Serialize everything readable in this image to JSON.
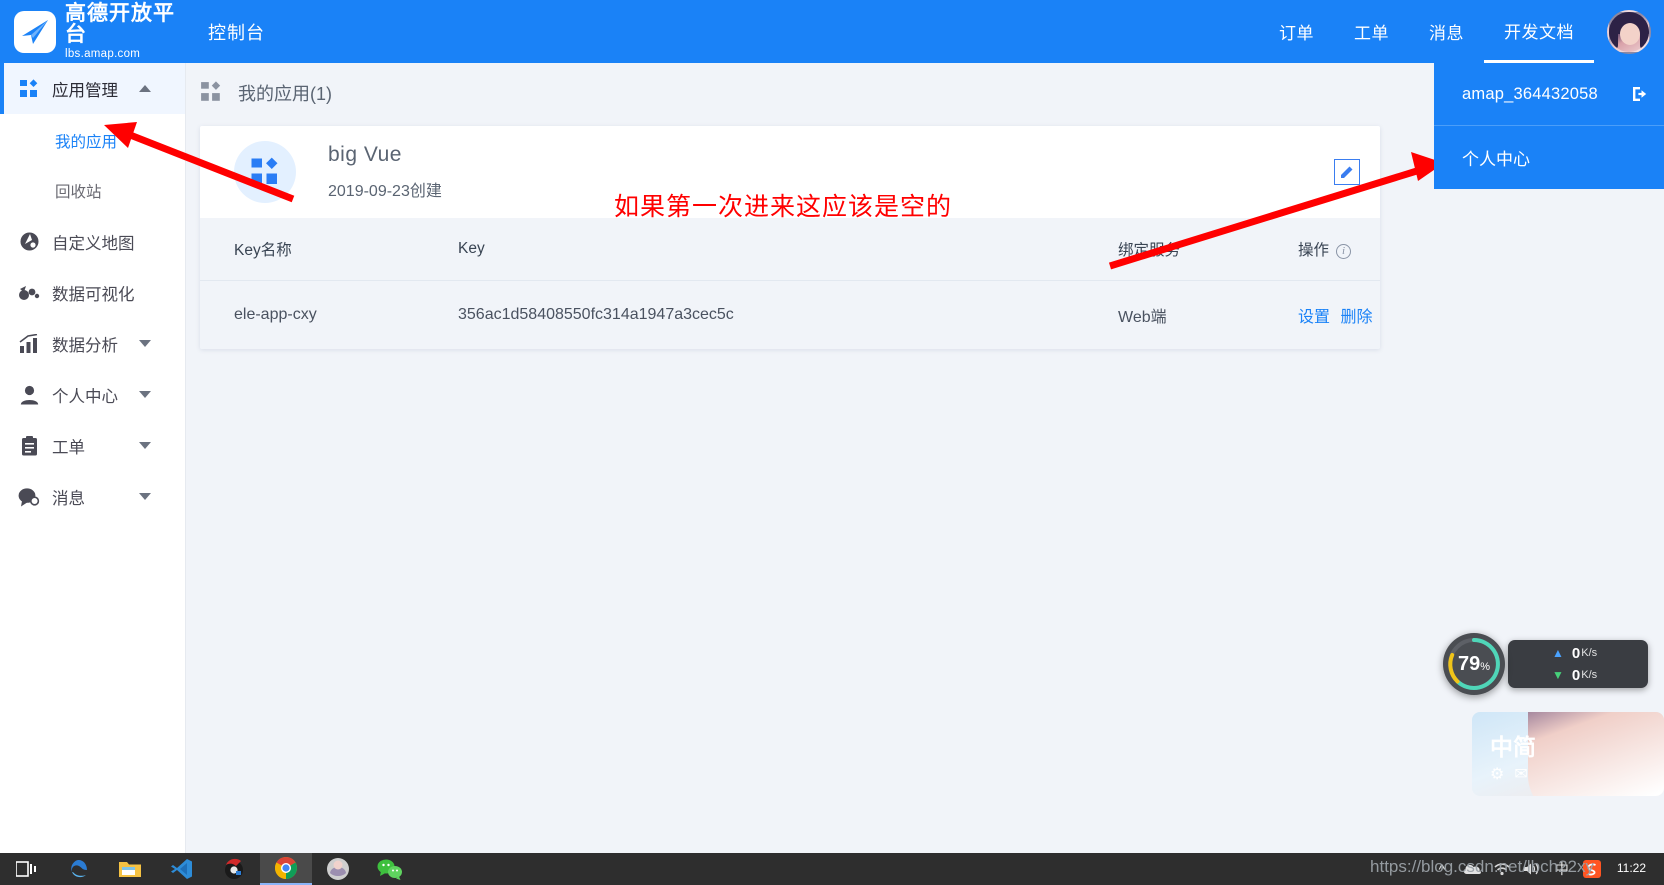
{
  "header": {
    "brand_title": "高德开放平台",
    "brand_sub": "lbs.amap.com",
    "console_title": "控制台",
    "nav": [
      {
        "label": "订单",
        "active": false
      },
      {
        "label": "工单",
        "active": false
      },
      {
        "label": "消息",
        "active": false
      },
      {
        "label": "开发文档",
        "active": true
      }
    ],
    "avatar_name": "avatar",
    "accent": "#1a82f7"
  },
  "user_dropdown": {
    "username": "amap_364432058",
    "logout_icon": "logout-icon",
    "personal_center": "个人中心"
  },
  "sidebar": {
    "items": [
      {
        "label": "应用管理",
        "icon": "apps-icon",
        "caret": "up",
        "active": true
      },
      {
        "label": "自定义地图",
        "icon": "map-icon",
        "caret": "",
        "active": false
      },
      {
        "label": "数据可视化",
        "icon": "visual-icon",
        "caret": "",
        "active": false
      },
      {
        "label": "数据分析",
        "icon": "chart-icon",
        "caret": "down",
        "active": false
      },
      {
        "label": "个人中心",
        "icon": "user-icon",
        "caret": "down",
        "active": false
      },
      {
        "label": "工单",
        "icon": "ticket-icon",
        "caret": "down",
        "active": false
      },
      {
        "label": "消息",
        "icon": "message-icon",
        "caret": "down",
        "active": false
      }
    ],
    "sub_items": [
      {
        "label": "我的应用",
        "active": true
      },
      {
        "label": "回收站",
        "active": false
      }
    ]
  },
  "main": {
    "page_title": "我的应用(1)",
    "page_icon": "apps-icon",
    "app": {
      "name": "big Vue",
      "created": "2019-09-23创建",
      "edit_icon": "edit-icon"
    },
    "table": {
      "columns": [
        "Key名称",
        "Key",
        "绑定服务",
        "操作"
      ],
      "operation_info_icon": "info-icon",
      "rows": [
        {
          "key_name": "ele-app-cxy",
          "key": "356ac1d58408550fc314a1947a3cec5c",
          "service": "Web端",
          "actions": [
            "设置",
            "删除"
          ]
        }
      ]
    }
  },
  "annotations": {
    "note": "如果第一次进来这应该是空的",
    "note_color": "#ff0000"
  },
  "widgets": {
    "cpu": {
      "value": "79",
      "unit": "%"
    },
    "net": {
      "up_value": "0",
      "up_unit": "K/s",
      "down_value": "0",
      "down_unit": "K/s"
    },
    "ime": {
      "label": "中简"
    }
  },
  "taskbar": {
    "icons": [
      "task-view-icon",
      "edge-icon",
      "file-explorer-icon",
      "vscode-icon",
      "navicat-icon",
      "chrome-icon",
      "qq-icon",
      "wechat-icon"
    ],
    "tray": [
      "show-hidden-icons",
      "onedrive-icon",
      "wifi-icon",
      "volume-icon",
      "ime-mode-icon",
      "sogou-icon"
    ],
    "clock": "11:22"
  },
  "watermark": {
    "text": "https://blog.csdn.net/lbch22xy"
  }
}
